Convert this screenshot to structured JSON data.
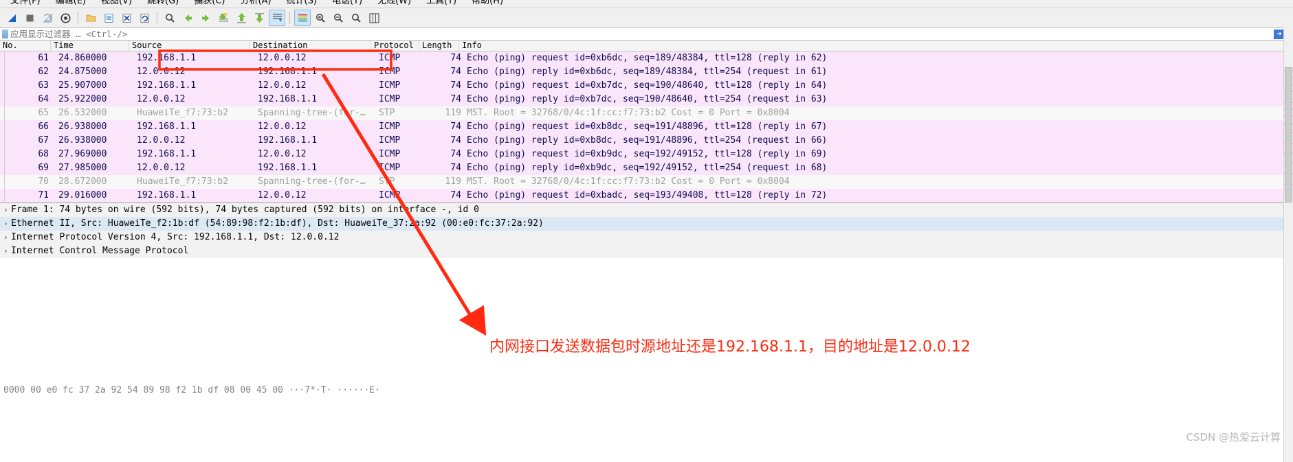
{
  "menu": {
    "items": [
      "文件(F)",
      "编辑(E)",
      "视图(V)",
      "跳转(G)",
      "捕获(C)",
      "分析(A)",
      "统计(S)",
      "电话(Y)",
      "无线(W)",
      "工具(T)",
      "帮助(H)"
    ]
  },
  "toolbar": {
    "icons": [
      "start-capture-icon",
      "stop-capture-icon",
      "restart-capture-icon",
      "capture-options-icon",
      "open-file-icon",
      "save-file-icon",
      "close-file-icon",
      "reload-file-icon",
      "find-packet-icon",
      "go-back-icon",
      "go-forward-icon",
      "go-to-packet-icon",
      "go-first-packet-icon",
      "go-last-packet-icon",
      "auto-scroll-icon",
      "colorize-icon",
      "zoom-in-icon",
      "zoom-out-icon",
      "zoom-reset-icon",
      "resize-columns-icon"
    ]
  },
  "filter": {
    "placeholder": "应用显示过滤器 … <Ctrl-/>",
    "value": "",
    "bookmark_icon": "bookmark-icon",
    "apply_icon": "arrow-right-icon",
    "expression_icon": "chevron-down-icon"
  },
  "packet_list": {
    "columns": [
      "No.",
      "Time",
      "Source",
      "Destination",
      "Protocol",
      "Length",
      "Info"
    ],
    "rows": [
      {
        "no": "61",
        "time": "24.860000",
        "source": "192.168.1.1",
        "destination": "12.0.0.12",
        "protocol": "ICMP",
        "length": "74",
        "info": "Echo (ping) request  id=0xb6dc, seq=189/48384, ttl=128 (reply in 62)",
        "type": "icmp",
        "highlight": true
      },
      {
        "no": "62",
        "time": "24.875000",
        "source": "12.0.0.12",
        "destination": "192.168.1.1",
        "protocol": "ICMP",
        "length": "74",
        "info": "Echo (ping) reply    id=0xb6dc, seq=189/48384, ttl=254 (request in 61)",
        "type": "icmp",
        "highlight": false
      },
      {
        "no": "63",
        "time": "25.907000",
        "source": "192.168.1.1",
        "destination": "12.0.0.12",
        "protocol": "ICMP",
        "length": "74",
        "info": "Echo (ping) request  id=0xb7dc, seq=190/48640, ttl=128 (reply in 64)",
        "type": "icmp",
        "highlight": false
      },
      {
        "no": "64",
        "time": "25.922000",
        "source": "12.0.0.12",
        "destination": "192.168.1.1",
        "protocol": "ICMP",
        "length": "74",
        "info": "Echo (ping) reply    id=0xb7dc, seq=190/48640, ttl=254 (request in 63)",
        "type": "icmp",
        "highlight": false
      },
      {
        "no": "65",
        "time": "26.532000",
        "source": "HuaweiTe_f7:73:b2",
        "destination": "Spanning-tree-(for-…",
        "protocol": "STP",
        "length": "119",
        "info": "MST. Root = 32768/0/4c:1f:cc:f7:73:b2  Cost = 0  Port = 0x8004",
        "type": "stp",
        "highlight": false
      },
      {
        "no": "66",
        "time": "26.938000",
        "source": "192.168.1.1",
        "destination": "12.0.0.12",
        "protocol": "ICMP",
        "length": "74",
        "info": "Echo (ping) request  id=0xb8dc, seq=191/48896, ttl=128 (reply in 67)",
        "type": "icmp",
        "highlight": false
      },
      {
        "no": "67",
        "time": "26.938000",
        "source": "12.0.0.12",
        "destination": "192.168.1.1",
        "protocol": "ICMP",
        "length": "74",
        "info": "Echo (ping) reply    id=0xb8dc, seq=191/48896, ttl=254 (request in 66)",
        "type": "icmp",
        "highlight": false
      },
      {
        "no": "68",
        "time": "27.969000",
        "source": "192.168.1.1",
        "destination": "12.0.0.12",
        "protocol": "ICMP",
        "length": "74",
        "info": "Echo (ping) request  id=0xb9dc, seq=192/49152, ttl=128 (reply in 69)",
        "type": "icmp",
        "highlight": false
      },
      {
        "no": "69",
        "time": "27.985000",
        "source": "12.0.0.12",
        "destination": "192.168.1.1",
        "protocol": "ICMP",
        "length": "74",
        "info": "Echo (ping) reply    id=0xb9dc, seq=192/49152, ttl=254 (request in 68)",
        "type": "icmp",
        "highlight": false
      },
      {
        "no": "70",
        "time": "28.672000",
        "source": "HuaweiTe_f7:73:b2",
        "destination": "Spanning-tree-(for-…",
        "protocol": "STP",
        "length": "119",
        "info": "MST. Root = 32768/0/4c:1f:cc:f7:73:b2  Cost = 0  Port = 0x8004",
        "type": "stp",
        "highlight": false
      },
      {
        "no": "71",
        "time": "29.016000",
        "source": "192.168.1.1",
        "destination": "12.0.0.12",
        "protocol": "ICMP",
        "length": "74",
        "info": "Echo (ping) request  id=0xbadc, seq=193/49408, ttl=128 (reply in 72)",
        "type": "icmp",
        "highlight": false
      }
    ]
  },
  "detail_pane": {
    "rows": [
      {
        "text": "Frame 1: 74 bytes on wire (592 bits), 74 bytes captured (592 bits) on interface -, id 0",
        "selected": false
      },
      {
        "text": "Ethernet II, Src: HuaweiTe_f2:1b:df (54:89:98:f2:1b:df), Dst: HuaweiTe_37:2a:92 (00:e0:fc:37:2a:92)",
        "selected": true
      },
      {
        "text": "Internet Protocol Version 4, Src: 192.168.1.1, Dst: 12.0.0.12",
        "selected": false
      },
      {
        "text": "Internet Control Message Protocol",
        "selected": false
      }
    ],
    "expander": "›"
  },
  "bytes_pane": {
    "line": "0000  00 e0 fc 37 2a 92 54 89  98 f2 1b df 08 00 45 00   ···7*·T· ······E·"
  },
  "annotation": {
    "text": "内网接口发送数据包时源地址还是192.168.1.1，目的地址是12.0.0.12",
    "color": "#ff2a10",
    "arrow_name": "red-arrow-annotation",
    "highlight_box_name": "red-highlight-box"
  },
  "watermark": {
    "text": "CSDN @热爱云计算"
  },
  "colors": {
    "icmp_row_bg": "#fbe5fb",
    "stp_row_bg": "#f8f8f8",
    "selected_detail_bg": "#dce9f5",
    "annotation_red": "#ff2a10"
  }
}
